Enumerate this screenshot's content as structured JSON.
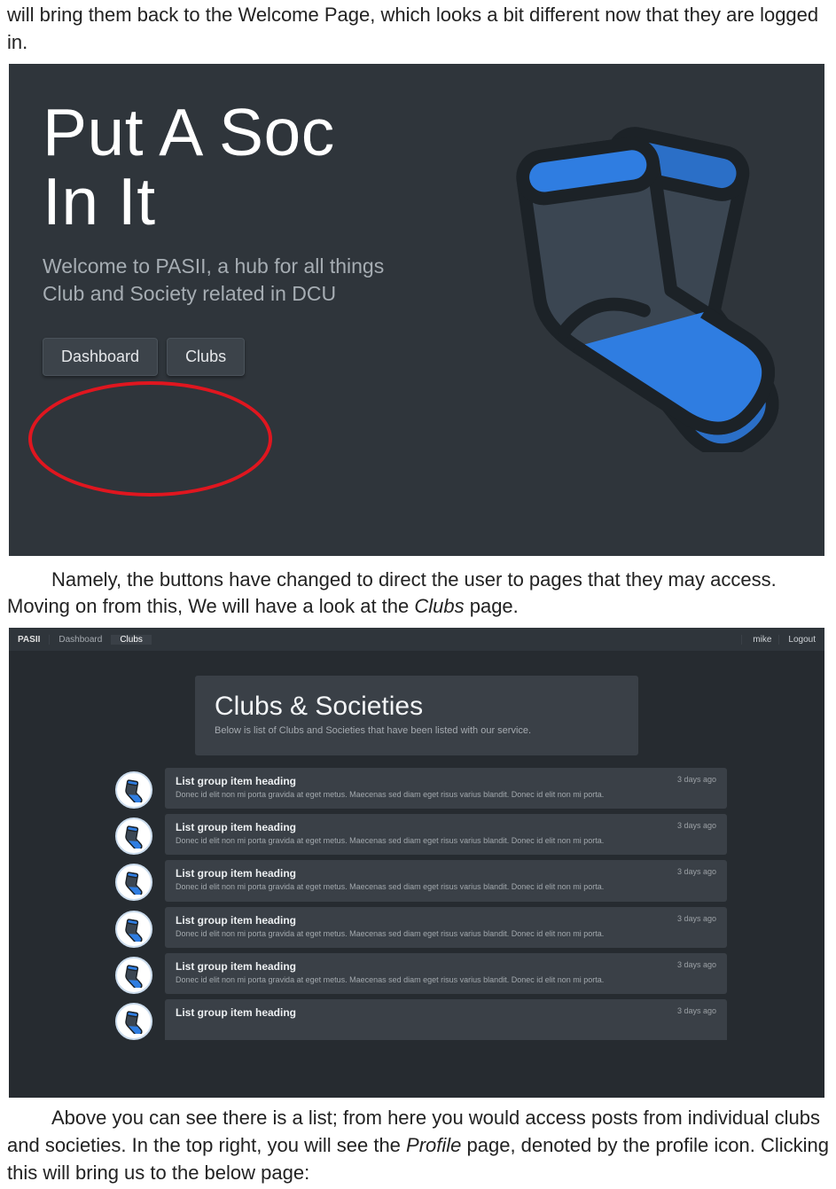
{
  "para1": "will bring them back to the Welcome Page, which looks a bit different now that they are logged in.",
  "para2_a": "Namely, the buttons have changed to direct the user to pages that they may access. Moving on from this, We will have a look at the ",
  "para2_italic": "Clubs",
  "para2_b": " page.",
  "para3_a": "Above you can see there is a list; from here you would access posts from individual clubs and societies. In the top right, you will see the ",
  "para3_italic": "Profile",
  "para3_b": " page, denoted by the profile icon. Clicking this will bring us to the below page:",
  "hero": {
    "title_line1": "Put A Soc",
    "title_line2": "In It",
    "subtitle": "Welcome to PASII, a hub for all things Club and Society related in DCU",
    "btn_dashboard": "Dashboard",
    "btn_clubs": "Clubs"
  },
  "clubs_page": {
    "nav": {
      "brand": "PASII",
      "dashboard": "Dashboard",
      "clubs": "Clubs",
      "user": "mike",
      "logout": "Logout"
    },
    "panel": {
      "title": "Clubs & Societies",
      "subtitle": "Below is list of Clubs and Societies that have been listed with our service."
    },
    "items": [
      {
        "heading": "List group item heading",
        "body": "Donec id elit non mi porta gravida at eget metus. Maecenas sed diam eget risus varius blandit. Donec id elit non mi porta.",
        "time": "3 days ago"
      },
      {
        "heading": "List group item heading",
        "body": "Donec id elit non mi porta gravida at eget metus. Maecenas sed diam eget risus varius blandit. Donec id elit non mi porta.",
        "time": "3 days ago"
      },
      {
        "heading": "List group item heading",
        "body": "Donec id elit non mi porta gravida at eget metus. Maecenas sed diam eget risus varius blandit. Donec id elit non mi porta.",
        "time": "3 days ago"
      },
      {
        "heading": "List group item heading",
        "body": "Donec id elit non mi porta gravida at eget metus. Maecenas sed diam eget risus varius blandit. Donec id elit non mi porta.",
        "time": "3 days ago"
      },
      {
        "heading": "List group item heading",
        "body": "Donec id elit non mi porta gravida at eget metus. Maecenas sed diam eget risus varius blandit. Donec id elit non mi porta.",
        "time": "3 days ago"
      },
      {
        "heading": "List group item heading",
        "body": "",
        "time": "3 days ago"
      }
    ]
  }
}
